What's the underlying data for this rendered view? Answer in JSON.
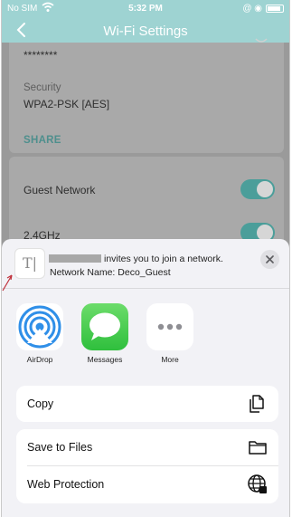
{
  "status_bar": {
    "carrier": "No SIM",
    "time": "5:32 PM",
    "right": "@ ◉"
  },
  "nav": {
    "title": "Wi-Fi Settings"
  },
  "settings": {
    "password_mask": "********",
    "security_label": "Security",
    "security_value": "WPA2-PSK [AES]",
    "share_label": "SHARE",
    "guest_network_label": "Guest Network",
    "band_label": "2.4GHz",
    "guest_network_on": true,
    "band_on": true
  },
  "share_sheet": {
    "invite_text": "invites you to join a network.",
    "network_name_text": "Network Name: Deco_Guest",
    "apps": [
      {
        "label": "AirDrop",
        "icon": "airdrop-icon"
      },
      {
        "label": "Messages",
        "icon": "messages-icon"
      },
      {
        "label": "More",
        "icon": "more-icon"
      }
    ],
    "actions": [
      {
        "label": "Copy",
        "icon": "copy-icon"
      },
      {
        "label": "Save to Files",
        "icon": "folder-icon"
      },
      {
        "label": "Web Protection",
        "icon": "globe-icon"
      }
    ]
  },
  "colors": {
    "accent": "#9ed3d2",
    "toggle_on": "#4b9e9a",
    "share": "#4e8f8d"
  }
}
